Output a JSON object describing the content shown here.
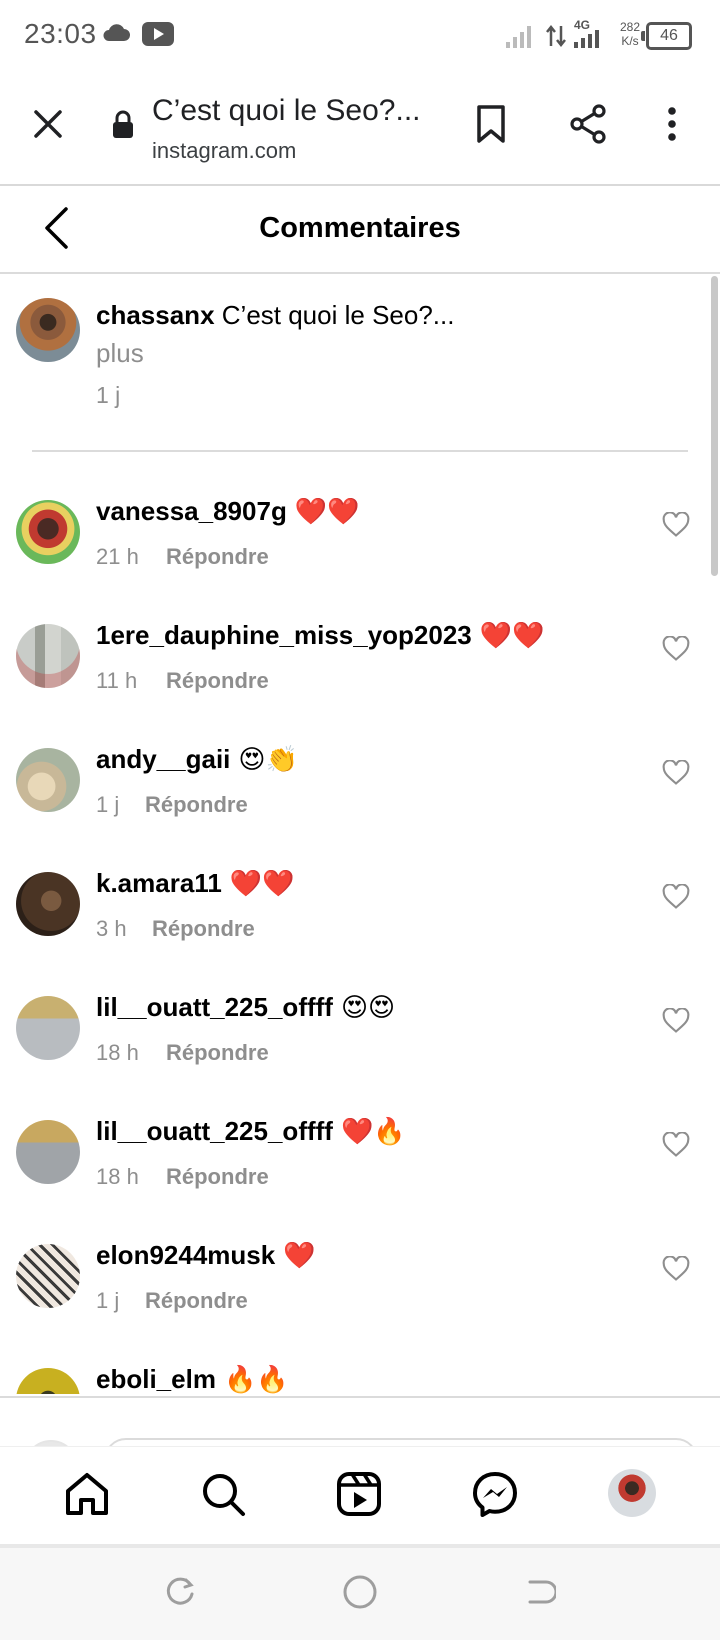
{
  "status_bar": {
    "time": "23:03",
    "network_type": "4G",
    "net_speed_value": "282",
    "net_speed_unit": "K/s",
    "battery": "46"
  },
  "browser": {
    "page_title": "C’est quoi le Seo?...",
    "url": "instagram.com"
  },
  "header": {
    "title": "Commentaires"
  },
  "caption": {
    "username": "chassanx",
    "text": "C’est quoi le Seo?...",
    "more": "plus",
    "time": "1 j"
  },
  "reply_label": "Répondre",
  "comments": [
    {
      "username": "vanessa_8907g",
      "emoji": "❤️❤️",
      "time": "21 h"
    },
    {
      "username": "1ere_dauphine_miss_yop2023",
      "emoji": "❤️❤️",
      "time": "11 h"
    },
    {
      "username": "andy__gaii",
      "emoji": "😍👏",
      "time": "1 j"
    },
    {
      "username": "k.amara11",
      "emoji": "❤️❤️",
      "time": "3 h"
    },
    {
      "username": "lil__ouatt_225_offff",
      "emoji": "😍😍",
      "time": "18 h"
    },
    {
      "username": "lil__ouatt_225_offff",
      "emoji": "❤️🔥",
      "time": "18 h"
    },
    {
      "username": "elon9244musk",
      "emoji": "❤️",
      "time": "1 j"
    },
    {
      "username": "eboli_elm",
      "emoji": "🔥🔥",
      "time": ""
    }
  ],
  "icons": {
    "close": "close-icon",
    "lock": "lock-icon",
    "bookmark": "bookmark-icon",
    "share": "share-icon",
    "more": "more-vertical-icon",
    "back": "back-arrow-icon",
    "heart": "heart-outline-icon",
    "home": "home-icon",
    "search": "search-icon",
    "reels": "reels-icon",
    "messenger": "messenger-icon"
  },
  "colors": {
    "text": "#000000",
    "secondary_text": "#8e8e8e",
    "divider": "#dbdbdb"
  }
}
